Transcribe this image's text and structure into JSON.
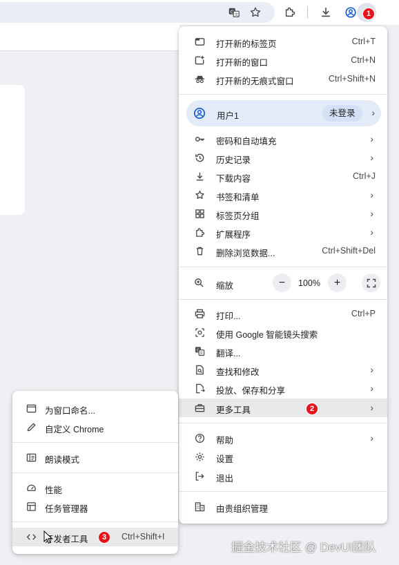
{
  "colors": {
    "accent": "#0b57d0",
    "marker": "#e8141b",
    "profile_bg": "#e3ebf8"
  },
  "markers": {
    "m1": "1",
    "m2": "2",
    "m3": "3"
  },
  "toolbar": {
    "icons": [
      "translate-icon",
      "star-icon",
      "extensions-icon",
      "download-icon",
      "profile-icon",
      "more-vert-icon"
    ]
  },
  "menu": {
    "new_tab": {
      "label": "打开新的标签页",
      "shortcut": "Ctrl+T"
    },
    "new_window": {
      "label": "打开新的窗口",
      "shortcut": "Ctrl+N"
    },
    "new_incognito": {
      "label": "打开新的无痕式窗口",
      "shortcut": "Ctrl+Shift+N"
    },
    "profile": {
      "label": "用户1",
      "badge": "未登录"
    },
    "passwords": {
      "label": "密码和自动填充"
    },
    "history": {
      "label": "历史记录"
    },
    "downloads": {
      "label": "下载内容",
      "shortcut": "Ctrl+J"
    },
    "bookmarks": {
      "label": "书签和清单"
    },
    "tab_groups": {
      "label": "标签页分组"
    },
    "extensions": {
      "label": "扩展程序"
    },
    "clear_data": {
      "label": "删除浏览数据...",
      "shortcut": "Ctrl+Shift+Del"
    },
    "zoom": {
      "label": "缩放",
      "value": "100%",
      "minus": "−",
      "plus": "+"
    },
    "print": {
      "label": "打印...",
      "shortcut": "Ctrl+P"
    },
    "lens": {
      "label": "使用 Google 智能镜头搜索"
    },
    "translate": {
      "label": "翻译..."
    },
    "find_edit": {
      "label": "查找和修改"
    },
    "cast_save_share": {
      "label": "投放、保存和分享"
    },
    "more_tools": {
      "label": "更多工具"
    },
    "help": {
      "label": "帮助"
    },
    "settings": {
      "label": "设置"
    },
    "exit": {
      "label": "退出"
    },
    "managed": {
      "label": "由贵组织管理"
    },
    "arrow": "›"
  },
  "submenu": {
    "name_window": {
      "label": "为窗口命名..."
    },
    "customize": {
      "label": "自定义 Chrome"
    },
    "reading_mode": {
      "label": "朗读模式"
    },
    "performance": {
      "label": "性能"
    },
    "task_manager": {
      "label": "任务管理器"
    },
    "dev_tools": {
      "label": "开发者工具",
      "shortcut": "Ctrl+Shift+I"
    }
  },
  "watermark": "掘金技术社区 @ DevUI团队"
}
